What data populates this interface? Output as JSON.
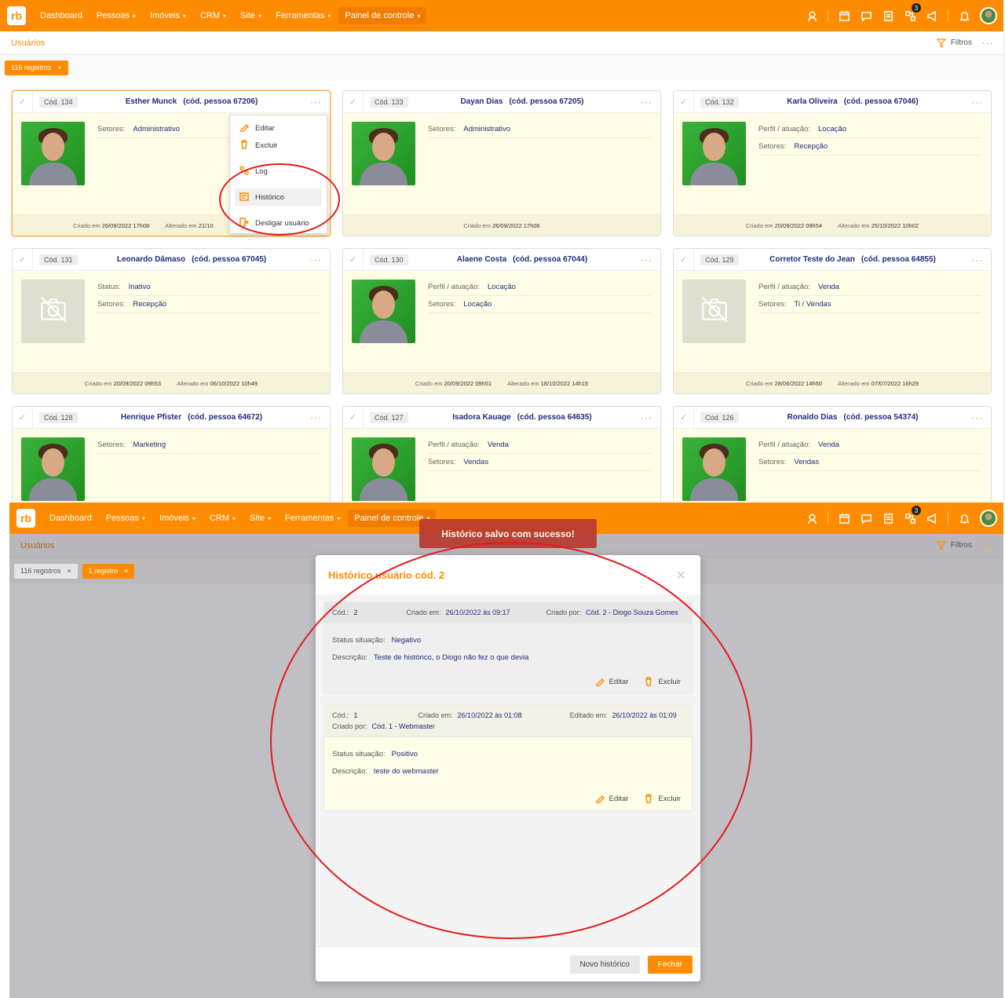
{
  "nav": {
    "items": [
      {
        "label": "Dashboard",
        "chevron": false
      },
      {
        "label": "Pessoas",
        "chevron": true
      },
      {
        "label": "Imóveis",
        "chevron": true
      },
      {
        "label": "CRM",
        "chevron": true
      },
      {
        "label": "Site",
        "chevron": true
      },
      {
        "label": "Ferramentas",
        "chevron": true
      },
      {
        "label": "Painel de controle",
        "chevron": true
      }
    ],
    "notification_count": "3",
    "logo_text": "rb"
  },
  "subbar": {
    "title": "Usuários",
    "filters_label": "Filtros",
    "more": "···"
  },
  "chips": {
    "all_records": "116 registros",
    "one_record": "1 registro",
    "close": "×"
  },
  "cards": [
    {
      "cod": "Cód. 134",
      "name": "Esther Munck",
      "pessoa": "(cód. pessoa 67206)",
      "photo": "green",
      "rows": [
        {
          "k": "Setores:",
          "v": "Administrativo"
        }
      ],
      "criado_label": "Criado em",
      "criado": "26/09/2022 17h08",
      "alterado_label": "Alterado em",
      "alterado": "21/10"
    },
    {
      "cod": "Cód. 133",
      "name": "Dayan Dias",
      "pessoa": "(cód. pessoa 67205)",
      "photo": "green",
      "rows": [
        {
          "k": "Setores:",
          "v": "Administrativo"
        }
      ],
      "criado_label": "Criado em",
      "criado": "26/09/2022 17h06",
      "alterado_label": "",
      "alterado": ""
    },
    {
      "cod": "Cód. 132",
      "name": "Karla Oliveira",
      "pessoa": "(cód. pessoa 67046)",
      "photo": "green",
      "rows": [
        {
          "k": "Perfil / atuação:",
          "v": "Locação"
        },
        {
          "k": "Setores:",
          "v": "Recepção"
        }
      ],
      "criado_label": "Criado em",
      "criado": "20/09/2022 09h54",
      "alterado_label": "Alterado em",
      "alterado": "25/10/2022 10h02"
    },
    {
      "cod": "Cód. 131",
      "name": "Leonardo Dâmaso",
      "pessoa": "(cód. pessoa 67045)",
      "photo": "none",
      "rows": [
        {
          "k": "Status:",
          "v": "Inativo"
        },
        {
          "k": "Setores:",
          "v": "Recepção"
        }
      ],
      "criado_label": "Criado em",
      "criado": "20/09/2022 09h53",
      "alterado_label": "Alterado em",
      "alterado": "06/10/2022 10h49"
    },
    {
      "cod": "Cód. 130",
      "name": "Alaene Costa",
      "pessoa": "(cód. pessoa 67044)",
      "photo": "green",
      "rows": [
        {
          "k": "Perfil / atuação:",
          "v": "Locação"
        },
        {
          "k": "Setores:",
          "v": "Locação"
        }
      ],
      "criado_label": "Criado em",
      "criado": "20/09/2022 09h51",
      "alterado_label": "Alterado em",
      "alterado": "18/10/2022 14h15"
    },
    {
      "cod": "Cód. 129",
      "name": "Corretor Teste do Jean",
      "pessoa": "(cód. pessoa 64855)",
      "photo": "none",
      "rows": [
        {
          "k": "Perfil / atuação:",
          "v": "Venda"
        },
        {
          "k": "Setores:",
          "v": "Ti / Vendas"
        }
      ],
      "criado_label": "Criado em",
      "criado": "28/06/2022 14h50",
      "alterado_label": "Alterado em",
      "alterado": "07/07/2022 16h29"
    },
    {
      "cod": "Cód. 128",
      "name": "Henrique Pfister",
      "pessoa": "(cód. pessoa 64672)",
      "photo": "green",
      "rows": [
        {
          "k": "Setores:",
          "v": "Marketing"
        }
      ],
      "criado_label": "",
      "criado": "",
      "alterado_label": "",
      "alterado": ""
    },
    {
      "cod": "Cód. 127",
      "name": "Isadora Kauage",
      "pessoa": "(cód. pessoa 64635)",
      "photo": "green",
      "rows": [
        {
          "k": "Perfil / atuação:",
          "v": "Venda"
        },
        {
          "k": "Setores:",
          "v": "Vendas"
        }
      ],
      "criado_label": "",
      "criado": "",
      "alterado_label": "",
      "alterado": ""
    },
    {
      "cod": "Cód. 126",
      "name": "Ronaldo Dias",
      "pessoa": "(cód. pessoa 54374)",
      "photo": "green",
      "rows": [
        {
          "k": "Perfil / atuação:",
          "v": "Venda"
        },
        {
          "k": "Setores:",
          "v": "Vendas"
        }
      ],
      "criado_label": "",
      "criado": "",
      "alterado_label": "",
      "alterado": ""
    }
  ],
  "context_menu": {
    "items": [
      "Editar",
      "Excluir",
      "Log",
      "Histórico",
      "Desligar usuário"
    ]
  },
  "toast": "Histórico salvo com sucesso!",
  "modal": {
    "title": "Histórico usuário cód. 2",
    "entries": [
      {
        "cod_label": "Cód.:",
        "cod": "2",
        "criado_label": "Criado em:",
        "criado": "26/10/2022 às 09:17",
        "por_label": "Criado por:",
        "por": "Cód. 2 - Diogo Souza Gomes",
        "editado_label": "",
        "editado": "",
        "status_label": "Status situação:",
        "status": "Negativo",
        "desc_label": "Descrição:",
        "desc": "Teste de histórico, o Diogo não fez o que devia"
      },
      {
        "cod_label": "Cód.:",
        "cod": "1",
        "criado_label": "Criado em:",
        "criado": "26/10/2022 às 01:08",
        "por_label": "Criado por:",
        "por": "Cód. 1 - Webmaster",
        "editado_label": "Editado em:",
        "editado": "26/10/2022 às 01:09",
        "status_label": "Status situação:",
        "status": "Positivo",
        "desc_label": "Descrição:",
        "desc": "teste do webmaster"
      }
    ],
    "edit_label": "Editar",
    "delete_label": "Excluir",
    "new_button": "Novo histórico",
    "close_button": "Fechar"
  }
}
